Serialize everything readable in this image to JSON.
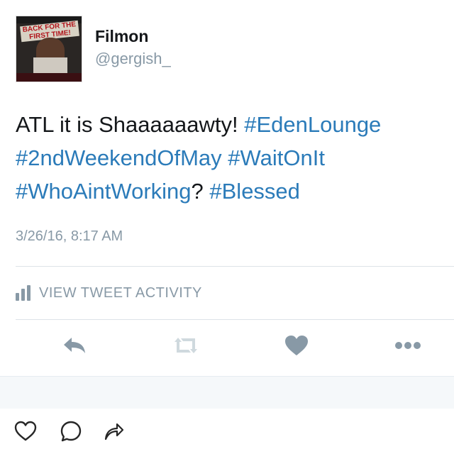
{
  "user": {
    "display_name": "Filmon",
    "handle": "@gergish_",
    "avatar": {
      "poster_title": "BACK FOR THE FIRST TIME!",
      "icon": "profile-poster"
    }
  },
  "tweet": {
    "segments": [
      {
        "text": "ATL it is Shaaaaaawty! ",
        "hashtag": false
      },
      {
        "text": "#EdenLounge",
        "hashtag": true
      },
      {
        "text": " ",
        "hashtag": false
      },
      {
        "text": "#2ndWeekendOfMay",
        "hashtag": true
      },
      {
        "text": " ",
        "hashtag": false
      },
      {
        "text": "#WaitOnIt",
        "hashtag": true
      },
      {
        "text": " ",
        "hashtag": false
      },
      {
        "text": "#WhoAintWorking",
        "hashtag": true
      },
      {
        "text": "? ",
        "hashtag": false
      },
      {
        "text": "#Blessed",
        "hashtag": true
      }
    ],
    "timestamp": "3/26/16, 8:17 AM"
  },
  "activity": {
    "label": "VIEW TWEET ACTIVITY",
    "icon": "bar-chart-icon"
  },
  "actions": [
    {
      "name": "reply-button",
      "icon": "reply-icon"
    },
    {
      "name": "retweet-button",
      "icon": "retweet-icon"
    },
    {
      "name": "like-button",
      "icon": "heart-icon"
    },
    {
      "name": "more-button",
      "icon": "more-dots-icon"
    }
  ],
  "instagram_actions": [
    {
      "name": "ig-like-button",
      "icon": "heart-outline-icon"
    },
    {
      "name": "ig-comment-button",
      "icon": "comment-bubble-icon"
    },
    {
      "name": "ig-share-button",
      "icon": "share-arrow-icon"
    }
  ],
  "colors": {
    "hashtag": "#2b7bb9",
    "secondary_text": "#8899a6",
    "action_icon": "#8899a6",
    "divider": "#dde3e8",
    "text": "#14171a"
  }
}
